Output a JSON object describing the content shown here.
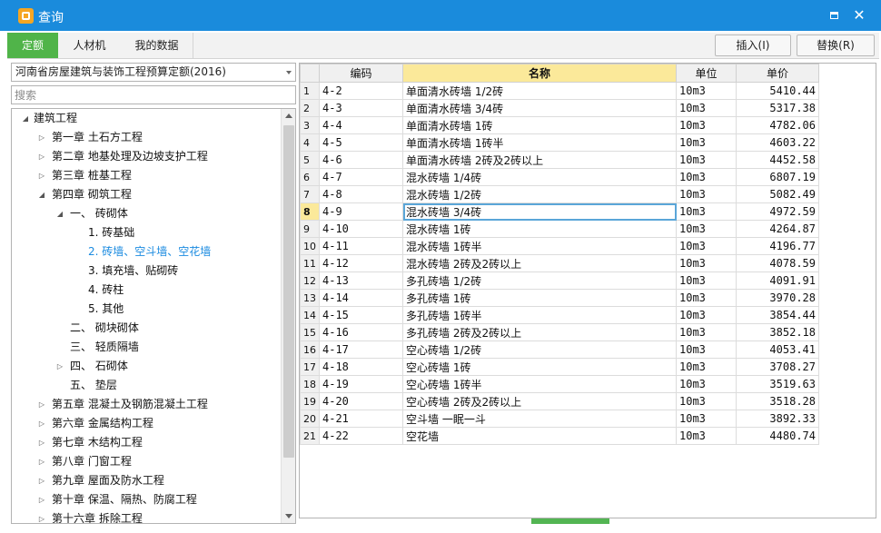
{
  "window": {
    "title": "查询",
    "icon": "app-icon"
  },
  "tabs": [
    {
      "label": "定额",
      "active": true
    },
    {
      "label": "人材机",
      "active": false
    },
    {
      "label": "我的数据",
      "active": false
    }
  ],
  "toolbar": {
    "insert_label": "插入(I)",
    "replace_label": "替换(R)"
  },
  "left": {
    "quota_library": "河南省房屋建筑与装饰工程预算定额(2016)",
    "search_placeholder": "搜索",
    "tree": [
      {
        "label": "建筑工程",
        "level": 0,
        "toggle": "expanded",
        "selected": false
      },
      {
        "label": "第一章  土石方工程",
        "level": 1,
        "toggle": "collapsed",
        "selected": false
      },
      {
        "label": "第二章  地基处理及边坡支护工程",
        "level": 1,
        "toggle": "collapsed",
        "selected": false
      },
      {
        "label": "第三章  桩基工程",
        "level": 1,
        "toggle": "collapsed",
        "selected": false
      },
      {
        "label": "第四章  砌筑工程",
        "level": 1,
        "toggle": "expanded",
        "selected": false
      },
      {
        "label": "一、  砖砌体",
        "level": 2,
        "toggle": "expanded",
        "selected": false
      },
      {
        "label": "1.  砖基础",
        "level": 3,
        "toggle": "none",
        "selected": false
      },
      {
        "label": "2.  砖墙、空斗墙、空花墙",
        "level": 3,
        "toggle": "none",
        "selected": true
      },
      {
        "label": "3.  填充墙、贴砌砖",
        "level": 3,
        "toggle": "none",
        "selected": false
      },
      {
        "label": "4.  砖柱",
        "level": 3,
        "toggle": "none",
        "selected": false
      },
      {
        "label": "5.  其他",
        "level": 3,
        "toggle": "none",
        "selected": false
      },
      {
        "label": "二、  砌块砌体",
        "level": 2,
        "toggle": "none",
        "selected": false
      },
      {
        "label": "三、  轻质隔墙",
        "level": 2,
        "toggle": "none",
        "selected": false
      },
      {
        "label": "四、  石砌体",
        "level": 2,
        "toggle": "collapsed",
        "selected": false
      },
      {
        "label": "五、  垫层",
        "level": 2,
        "toggle": "none",
        "selected": false
      },
      {
        "label": "第五章 混凝土及钢筋混凝土工程",
        "level": 1,
        "toggle": "collapsed",
        "selected": false
      },
      {
        "label": "第六章  金属结构工程",
        "level": 1,
        "toggle": "collapsed",
        "selected": false
      },
      {
        "label": "第七章  木结构工程",
        "level": 1,
        "toggle": "collapsed",
        "selected": false
      },
      {
        "label": "第八章  门窗工程",
        "level": 1,
        "toggle": "collapsed",
        "selected": false
      },
      {
        "label": "第九章  屋面及防水工程",
        "level": 1,
        "toggle": "collapsed",
        "selected": false
      },
      {
        "label": "第十章  保温、隔热、防腐工程",
        "level": 1,
        "toggle": "collapsed",
        "selected": false
      },
      {
        "label": "第十六章  拆除工程",
        "level": 1,
        "toggle": "collapsed",
        "selected": false
      }
    ]
  },
  "grid": {
    "columns": {
      "code": "编码",
      "name": "名称",
      "unit": "单位",
      "price": "单价"
    },
    "current_row": 8,
    "rows": [
      {
        "n": "1",
        "code": "4-2",
        "name": "单面清水砖墙 1/2砖",
        "unit": "10m3",
        "price": "5410.44"
      },
      {
        "n": "2",
        "code": "4-3",
        "name": "单面清水砖墙 3/4砖",
        "unit": "10m3",
        "price": "5317.38"
      },
      {
        "n": "3",
        "code": "4-4",
        "name": "单面清水砖墙 1砖",
        "unit": "10m3",
        "price": "4782.06"
      },
      {
        "n": "4",
        "code": "4-5",
        "name": "单面清水砖墙 1砖半",
        "unit": "10m3",
        "price": "4603.22"
      },
      {
        "n": "5",
        "code": "4-6",
        "name": "单面清水砖墙 2砖及2砖以上",
        "unit": "10m3",
        "price": "4452.58"
      },
      {
        "n": "6",
        "code": "4-7",
        "name": "混水砖墙 1/4砖",
        "unit": "10m3",
        "price": "6807.19"
      },
      {
        "n": "7",
        "code": "4-8",
        "name": "混水砖墙 1/2砖",
        "unit": "10m3",
        "price": "5082.49"
      },
      {
        "n": "8",
        "code": "4-9",
        "name": "混水砖墙 3/4砖",
        "unit": "10m3",
        "price": "4972.59"
      },
      {
        "n": "9",
        "code": "4-10",
        "name": "混水砖墙 1砖",
        "unit": "10m3",
        "price": "4264.87"
      },
      {
        "n": "10",
        "code": "4-11",
        "name": "混水砖墙 1砖半",
        "unit": "10m3",
        "price": "4196.77"
      },
      {
        "n": "11",
        "code": "4-12",
        "name": "混水砖墙 2砖及2砖以上",
        "unit": "10m3",
        "price": "4078.59"
      },
      {
        "n": "12",
        "code": "4-13",
        "name": "多孔砖墙 1/2砖",
        "unit": "10m3",
        "price": "4091.91"
      },
      {
        "n": "13",
        "code": "4-14",
        "name": "多孔砖墙 1砖",
        "unit": "10m3",
        "price": "3970.28"
      },
      {
        "n": "14",
        "code": "4-15",
        "name": "多孔砖墙 1砖半",
        "unit": "10m3",
        "price": "3854.44"
      },
      {
        "n": "15",
        "code": "4-16",
        "name": "多孔砖墙 2砖及2砖以上",
        "unit": "10m3",
        "price": "3852.18"
      },
      {
        "n": "16",
        "code": "4-17",
        "name": "空心砖墙 1/2砖",
        "unit": "10m3",
        "price": "4053.41"
      },
      {
        "n": "17",
        "code": "4-18",
        "name": "空心砖墙 1砖",
        "unit": "10m3",
        "price": "3708.27"
      },
      {
        "n": "18",
        "code": "4-19",
        "name": "空心砖墙 1砖半",
        "unit": "10m3",
        "price": "3519.63"
      },
      {
        "n": "19",
        "code": "4-20",
        "name": "空心砖墙 2砖及2砖以上",
        "unit": "10m3",
        "price": "3518.28"
      },
      {
        "n": "20",
        "code": "4-21",
        "name": "空斗墙 一眠一斗",
        "unit": "10m3",
        "price": "3892.33"
      },
      {
        "n": "21",
        "code": "4-22",
        "name": "空花墙",
        "unit": "10m3",
        "price": "4480.74"
      }
    ]
  },
  "colors": {
    "titlebar": "#1a8bdc",
    "active_tab": "#50b449",
    "highlight": "#fbe99a",
    "selected_tree": "#1b8be0"
  }
}
